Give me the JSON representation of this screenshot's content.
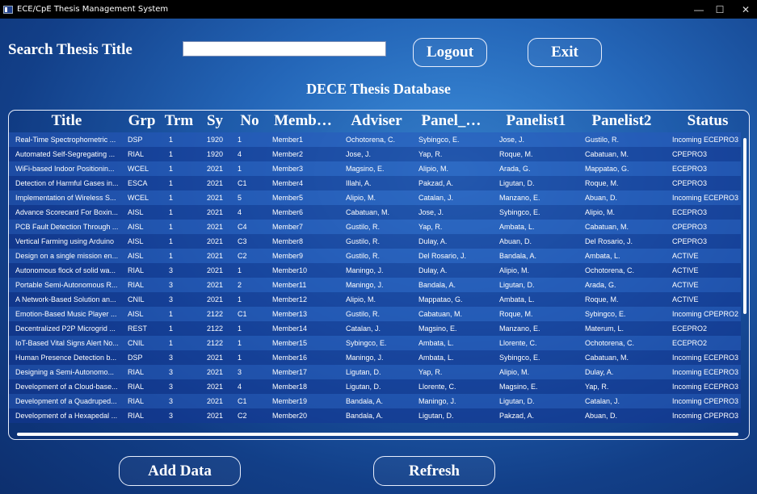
{
  "window": {
    "title": "ECE/CpE Thesis Management System",
    "min": "—",
    "max": "☐",
    "close": "✕"
  },
  "search": {
    "label": "Search Thesis Title",
    "value": "",
    "placeholder": ""
  },
  "buttons": {
    "logout": "Logout",
    "exit": "Exit",
    "add": "Add Data",
    "refresh": "Refresh"
  },
  "database_title": "DECE Thesis Database",
  "table": {
    "columns": [
      "Title",
      "Grp",
      "Trm",
      "Sy",
      "No",
      "Memb…",
      "Adviser",
      "Panel_…",
      "Panelist1",
      "Panelist2",
      "Status"
    ],
    "rows": [
      [
        "Real-Time Spectrophometric ...",
        "DSP",
        "1",
        "1920",
        "1",
        "Member1",
        "Ochotorena, C.",
        "Sybingco, E.",
        "Jose, J.",
        "Gustilo, R.",
        "Incoming ECEPRO3"
      ],
      [
        "Automated Self-Segregating ...",
        "RIAL",
        "1",
        "1920",
        "4",
        "Member2",
        "Jose, J.",
        "Yap, R.",
        "Roque, M.",
        "Cabatuan, M.",
        "CPEPRO3"
      ],
      [
        "WiFi-based Indoor Positionin...",
        "WCEL",
        "1",
        "2021",
        "1",
        "Member3",
        "Magsino, E.",
        "Alipio, M.",
        "Arada, G.",
        "Mappatao, G.",
        "ECEPRO3"
      ],
      [
        "Detection of Harmful Gases in...",
        "ESCA",
        "1",
        "2021",
        "C1",
        "Member4",
        "Illahi, A.",
        "Pakzad, A.",
        "Ligutan, D.",
        "Roque, M.",
        "CPEPRO3"
      ],
      [
        "Implementation of Wireless S...",
        "WCEL",
        "1",
        "2021",
        "5",
        "Member5",
        "Alipio, M.",
        "Catalan, J.",
        "Manzano, E.",
        "Abuan, D.",
        "Incoming ECEPRO3"
      ],
      [
        "Advance Scorecard For Boxin...",
        "AISL",
        "1",
        "2021",
        "4",
        "Member6",
        "Cabatuan, M.",
        "Jose, J.",
        "Sybingco, E.",
        "Alipio, M.",
        "ECEPRO3"
      ],
      [
        "PCB Fault Detection Through ...",
        "AISL",
        "1",
        "2021",
        "C4",
        "Member7",
        "Gustilo, R.",
        "Yap, R.",
        "Ambata, L.",
        "Cabatuan, M.",
        "CPEPRO3"
      ],
      [
        "Vertical Farming using Arduino",
        "AISL",
        "1",
        "2021",
        "C3",
        "Member8",
        "Gustilo, R.",
        "Dulay, A.",
        "Abuan, D.",
        "Del Rosario, J.",
        "CPEPRO3"
      ],
      [
        "Design on a single mission en...",
        "AISL",
        "1",
        "2021",
        "C2",
        "Member9",
        "Gustilo, R.",
        "Del Rosario, J.",
        "Bandala, A.",
        "Ambata, L.",
        "ACTIVE"
      ],
      [
        "Autonomous flock of solid wa...",
        "RIAL",
        "3",
        "2021",
        "1",
        "Member10",
        "Maningo, J.",
        "Dulay, A.",
        "Alipio, M.",
        "Ochotorena, C.",
        "ACTIVE"
      ],
      [
        "Portable Semi-Autonomous R...",
        "RIAL",
        "3",
        "2021",
        "2",
        "Member11",
        "Maningo, J.",
        "Bandala, A.",
        "Ligutan, D.",
        "Arada, G.",
        "ACTIVE"
      ],
      [
        "A Network-Based Solution an...",
        "CNIL",
        "3",
        "2021",
        "1",
        "Member12",
        "Alipio, M.",
        "Mappatao, G.",
        "Ambata, L.",
        "Roque, M.",
        "ACTIVE"
      ],
      [
        "Emotion-Based Music Player ...",
        "AISL",
        "1",
        "2122",
        "C1",
        "Member13",
        "Gustilo, R.",
        "Cabatuan, M.",
        "Roque, M.",
        "Sybingco, E.",
        "Incoming CPEPRO2"
      ],
      [
        "Decentralized P2P Microgrid ...",
        "REST",
        "1",
        "2122",
        "1",
        "Member14",
        "Catalan, J.",
        "Magsino, E.",
        "Manzano, E.",
        "Materum, L.",
        "ECEPRO2"
      ],
      [
        "IoT-Based Vital Signs Alert No...",
        "CNIL",
        "1",
        "2122",
        "1",
        "Member15",
        "Sybingco, E.",
        "Ambata, L.",
        "Llorente, C.",
        "Ochotorena, C.",
        "ECEPRO2"
      ],
      [
        "Human Presence Detection b...",
        "DSP",
        "3",
        "2021",
        "1",
        "Member16",
        "Maningo, J.",
        "Ambata, L.",
        "Sybingco, E.",
        "Cabatuan, M.",
        "Incoming ECEPRO3"
      ],
      [
        "Designing a Semi-Autonomo...",
        "RIAL",
        "3",
        "2021",
        "3",
        "Member17",
        "Ligutan, D.",
        "Yap, R.",
        "Alipio, M.",
        "Dulay, A.",
        "Incoming ECEPRO3"
      ],
      [
        "Development of a Cloud-base...",
        "RIAL",
        "3",
        "2021",
        "4",
        "Member18",
        "Ligutan, D.",
        "Llorente, C.",
        "Magsino, E.",
        "Yap, R.",
        "Incoming ECEPRO3"
      ],
      [
        "Development of a Quadruped...",
        "RIAL",
        "3",
        "2021",
        "C1",
        "Member19",
        "Bandala, A.",
        "Maningo, J.",
        "Ligutan, D.",
        "Catalan, J.",
        "Incoming CPEPRO3"
      ],
      [
        "Development of a Hexapedal ...",
        "RIAL",
        "3",
        "2021",
        "C2",
        "Member20",
        "Bandala, A.",
        "Ligutan, D.",
        "Pakzad, A.",
        "Abuan, D.",
        "Incoming CPEPRO3"
      ]
    ]
  }
}
